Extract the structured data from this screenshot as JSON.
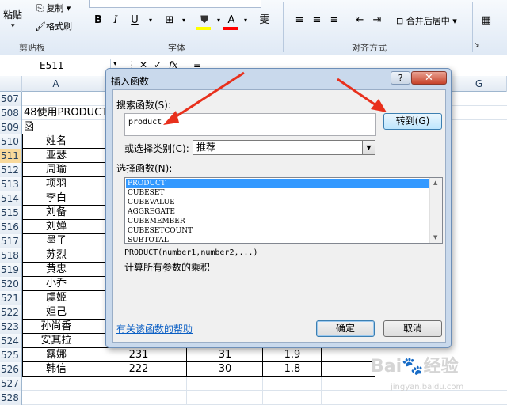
{
  "ribbon": {
    "paste_label": "粘贴",
    "copy_label": "复制",
    "format_painter_label": "格式刷",
    "clipboard_group": "剪贴板",
    "font_group": "字体",
    "align_group": "对齐方式",
    "merge_center_label": "合并后居中",
    "bold_label": "B",
    "italic_label": "I",
    "underline_label": "U",
    "phonetic_label": "雯"
  },
  "formula_bar": {
    "name_box": "E511",
    "fx_label": "fx",
    "content": "="
  },
  "sheet": {
    "columns": [
      "A",
      "G"
    ],
    "rows": [
      {
        "num": "507",
        "a": "",
        "b": "",
        "c": "",
        "d": "",
        "selected": false
      },
      {
        "num": "508",
        "a": "48使用PRODUCT函",
        "b": "",
        "c": "",
        "d": "",
        "selected": false
      },
      {
        "num": "509",
        "a": "",
        "b": "",
        "c": "",
        "d": "",
        "selected": false
      },
      {
        "num": "510",
        "a": "姓名",
        "b": "",
        "c": "",
        "d": "",
        "selected": false
      },
      {
        "num": "511",
        "a": "亚瑟",
        "b": "",
        "c": "",
        "d": "",
        "selected": true
      },
      {
        "num": "512",
        "a": "周瑜",
        "b": "",
        "c": "",
        "d": "",
        "selected": false
      },
      {
        "num": "513",
        "a": "项羽",
        "b": "",
        "c": "",
        "d": "",
        "selected": false
      },
      {
        "num": "514",
        "a": "李白",
        "b": "",
        "c": "",
        "d": "",
        "selected": false
      },
      {
        "num": "515",
        "a": "刘备",
        "b": "",
        "c": "",
        "d": "",
        "selected": false
      },
      {
        "num": "516",
        "a": "刘婵",
        "b": "",
        "c": "",
        "d": "",
        "selected": false
      },
      {
        "num": "517",
        "a": "墨子",
        "b": "",
        "c": "",
        "d": "",
        "selected": false
      },
      {
        "num": "518",
        "a": "苏烈",
        "b": "",
        "c": "",
        "d": "",
        "selected": false
      },
      {
        "num": "519",
        "a": "黄忠",
        "b": "",
        "c": "",
        "d": "",
        "selected": false
      },
      {
        "num": "520",
        "a": "小乔",
        "b": "",
        "c": "",
        "d": "",
        "selected": false
      },
      {
        "num": "521",
        "a": "虞姬",
        "b": "",
        "c": "",
        "d": "",
        "selected": false
      },
      {
        "num": "522",
        "a": "妲己",
        "b": "",
        "c": "",
        "d": "",
        "selected": false
      },
      {
        "num": "523",
        "a": "孙尚香",
        "b": "",
        "c": "",
        "d": "",
        "selected": false
      },
      {
        "num": "524",
        "a": "安其拉",
        "b": "",
        "c": "",
        "d": "",
        "selected": false
      },
      {
        "num": "525",
        "a": "露娜",
        "b": "231",
        "c": "31",
        "d": "1.9",
        "selected": false
      },
      {
        "num": "526",
        "a": "韩信",
        "b": "222",
        "c": "30",
        "d": "1.8",
        "selected": false
      },
      {
        "num": "527",
        "a": "",
        "b": "",
        "c": "",
        "d": "",
        "selected": false
      },
      {
        "num": "528",
        "a": "",
        "b": "",
        "c": "",
        "d": "",
        "selected": false
      }
    ]
  },
  "dialog": {
    "title": "插入函数",
    "help_btn": "?",
    "close_btn": "✕",
    "search_label": "搜索函数(S):",
    "search_value": "product",
    "goto_btn": "转到(G)",
    "category_label": "或选择类别(C):",
    "category_value": "推荐",
    "select_label": "选择函数(N):",
    "functions": [
      "PRODUCT",
      "CUBESET",
      "CUBEVALUE",
      "AGGREGATE",
      "CUBEMEMBER",
      "CUBESETCOUNT",
      "SUBTOTAL"
    ],
    "syntax": "PRODUCT(number1,number2,...)",
    "description": "计算所有参数的乘积",
    "help_link": "有关该函数的帮助",
    "ok_btn": "确定",
    "cancel_btn": "取消"
  },
  "watermark": {
    "brand": "Bai 经验",
    "url": "jingyan.baidu.com"
  },
  "colors": {
    "accent": "#3399ff",
    "arrow": "#e8301c",
    "selected_row": "#f9d99a"
  }
}
